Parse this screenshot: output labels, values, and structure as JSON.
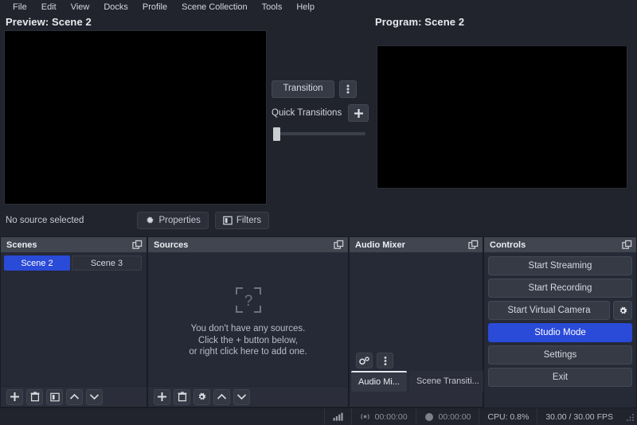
{
  "menubar": {
    "items": [
      {
        "label": "File"
      },
      {
        "label": "Edit"
      },
      {
        "label": "View"
      },
      {
        "label": "Docks"
      },
      {
        "label": "Profile"
      },
      {
        "label": "Scene Collection"
      },
      {
        "label": "Tools"
      },
      {
        "label": "Help"
      }
    ]
  },
  "preview": {
    "title": "Preview: Scene 2"
  },
  "program": {
    "title": "Program: Scene 2"
  },
  "transitions": {
    "transition_label": "Transition",
    "menu_icon": "vertical-dots-icon",
    "quick_transitions_label": "Quick Transitions",
    "add_label": "+",
    "tbar_value": 0
  },
  "source_bar": {
    "status_text": "No source selected",
    "properties_label": "Properties",
    "filters_label": "Filters"
  },
  "scenes": {
    "title": "Scenes",
    "items": [
      {
        "label": "Scene 2",
        "active": true
      },
      {
        "label": "Scene 3",
        "active": false
      }
    ],
    "toolbar": [
      "add-icon",
      "remove-icon",
      "filters-icon",
      "move-up-icon",
      "move-down-icon"
    ]
  },
  "sources": {
    "title": "Sources",
    "empty": {
      "line1": "You don't have any sources.",
      "line2": "Click the + button below,",
      "line3": "or right click here to add one."
    },
    "toolbar": [
      "add-icon",
      "remove-icon",
      "properties-icon",
      "move-up-icon",
      "move-down-icon"
    ]
  },
  "mixer": {
    "title": "Audio Mixer",
    "toolbar": [
      "advanced-audio-properties-icon",
      "vertical-dots-icon"
    ],
    "tabs": [
      {
        "label": "Audio Mi...",
        "active": true
      },
      {
        "label": "Scene Transiti...",
        "active": false
      }
    ]
  },
  "controls": {
    "title": "Controls",
    "buttons": [
      {
        "label": "Start Streaming",
        "active": false
      },
      {
        "label": "Start Recording",
        "active": false
      },
      {
        "label": "Start Virtual Camera",
        "active": false
      },
      {
        "label": "Studio Mode",
        "active": true
      },
      {
        "label": "Settings",
        "active": false
      },
      {
        "label": "Exit",
        "active": false
      }
    ],
    "virtual_camera_settings_icon": "gear-icon"
  },
  "statusbar": {
    "signal_icon": "signal-bars-icon",
    "stream_icon": "broadcast-icon",
    "stream_time": "00:00:00",
    "record_icon": "record-dot-icon",
    "record_time": "00:00:00",
    "cpu": "CPU: 0.8%",
    "fps": "30.00 / 30.00 FPS"
  },
  "colors": {
    "accent": "#2a4ad8",
    "background": "#21232d",
    "dock_header": "#414550",
    "canvas": "#000000"
  }
}
